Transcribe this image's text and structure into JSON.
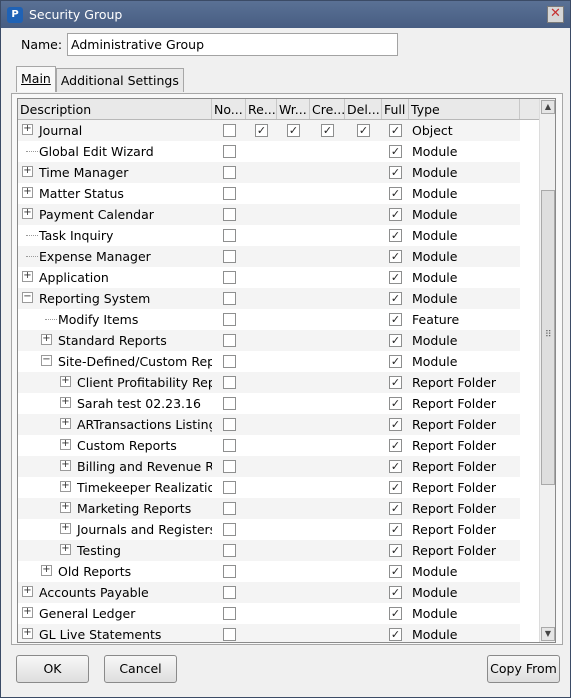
{
  "window": {
    "title": "Security Group",
    "close_glyph": "✕"
  },
  "name_label": "Name:",
  "name_value": "Administrative Group",
  "tabs": [
    {
      "label": "Main"
    },
    {
      "label": "Additional Settings"
    }
  ],
  "columns": [
    "Description",
    "No...",
    "Re...",
    "Wr...",
    "Cre...",
    "Del...",
    "Full",
    "Type"
  ],
  "rows": [
    {
      "label": "Journal",
      "level": 0,
      "expander": "+",
      "none": false,
      "read": true,
      "write": true,
      "create": true,
      "delete": true,
      "full": true,
      "type": "Object"
    },
    {
      "label": "Global Edit Wizard",
      "level": 0,
      "expander": "",
      "full": true,
      "type": "Module"
    },
    {
      "label": "Time Manager",
      "level": 0,
      "expander": "+",
      "full": true,
      "type": "Module"
    },
    {
      "label": "Matter Status",
      "level": 0,
      "expander": "+",
      "full": true,
      "type": "Module"
    },
    {
      "label": "Payment Calendar",
      "level": 0,
      "expander": "+",
      "full": true,
      "type": "Module"
    },
    {
      "label": "Task Inquiry",
      "level": 0,
      "expander": "",
      "full": true,
      "type": "Module"
    },
    {
      "label": "Expense Manager",
      "level": 0,
      "expander": "",
      "full": true,
      "type": "Module"
    },
    {
      "label": "Application",
      "level": 0,
      "expander": "+",
      "full": true,
      "type": "Module"
    },
    {
      "label": "Reporting System",
      "level": 0,
      "expander": "−",
      "full": true,
      "type": "Module"
    },
    {
      "label": "Modify Items",
      "level": 1,
      "expander": "",
      "full": true,
      "type": "Feature"
    },
    {
      "label": "Standard Reports",
      "level": 1,
      "expander": "+",
      "full": true,
      "type": "Module"
    },
    {
      "label": "Site-Defined/Custom Reports",
      "level": 1,
      "expander": "−",
      "full": true,
      "type": "Module"
    },
    {
      "label": "Client Profitability Reports",
      "level": 2,
      "expander": "+",
      "full": true,
      "type": "Report Folder"
    },
    {
      "label": "Sarah test 02.23.16",
      "level": 2,
      "expander": "+",
      "full": true,
      "type": "Report Folder"
    },
    {
      "label": "ARTransactions Listings",
      "level": 2,
      "expander": "+",
      "full": true,
      "type": "Report Folder"
    },
    {
      "label": "Custom Reports",
      "level": 2,
      "expander": "+",
      "full": true,
      "type": "Report Folder"
    },
    {
      "label": "Billing and Revenue Reports",
      "level": 2,
      "expander": "+",
      "full": true,
      "type": "Report Folder"
    },
    {
      "label": "Timekeeper Realization",
      "level": 2,
      "expander": "+",
      "full": true,
      "type": "Report Folder"
    },
    {
      "label": "Marketing Reports",
      "level": 2,
      "expander": "+",
      "full": true,
      "type": "Report Folder"
    },
    {
      "label": "Journals and Registers",
      "level": 2,
      "expander": "+",
      "full": true,
      "type": "Report Folder"
    },
    {
      "label": "Testing",
      "level": 2,
      "expander": "+",
      "full": true,
      "type": "Report Folder"
    },
    {
      "label": "Old Reports",
      "level": 1,
      "expander": "+",
      "full": true,
      "type": "Module"
    },
    {
      "label": "Accounts Payable",
      "level": 0,
      "expander": "+",
      "full": true,
      "type": "Module"
    },
    {
      "label": "General Ledger",
      "level": 0,
      "expander": "+",
      "full": true,
      "type": "Module"
    },
    {
      "label": "GL Live Statements",
      "level": 0,
      "expander": "+",
      "full": true,
      "type": "Module"
    }
  ],
  "buttons": {
    "ok": "OK",
    "cancel": "Cancel",
    "copy_from": "Copy From"
  }
}
